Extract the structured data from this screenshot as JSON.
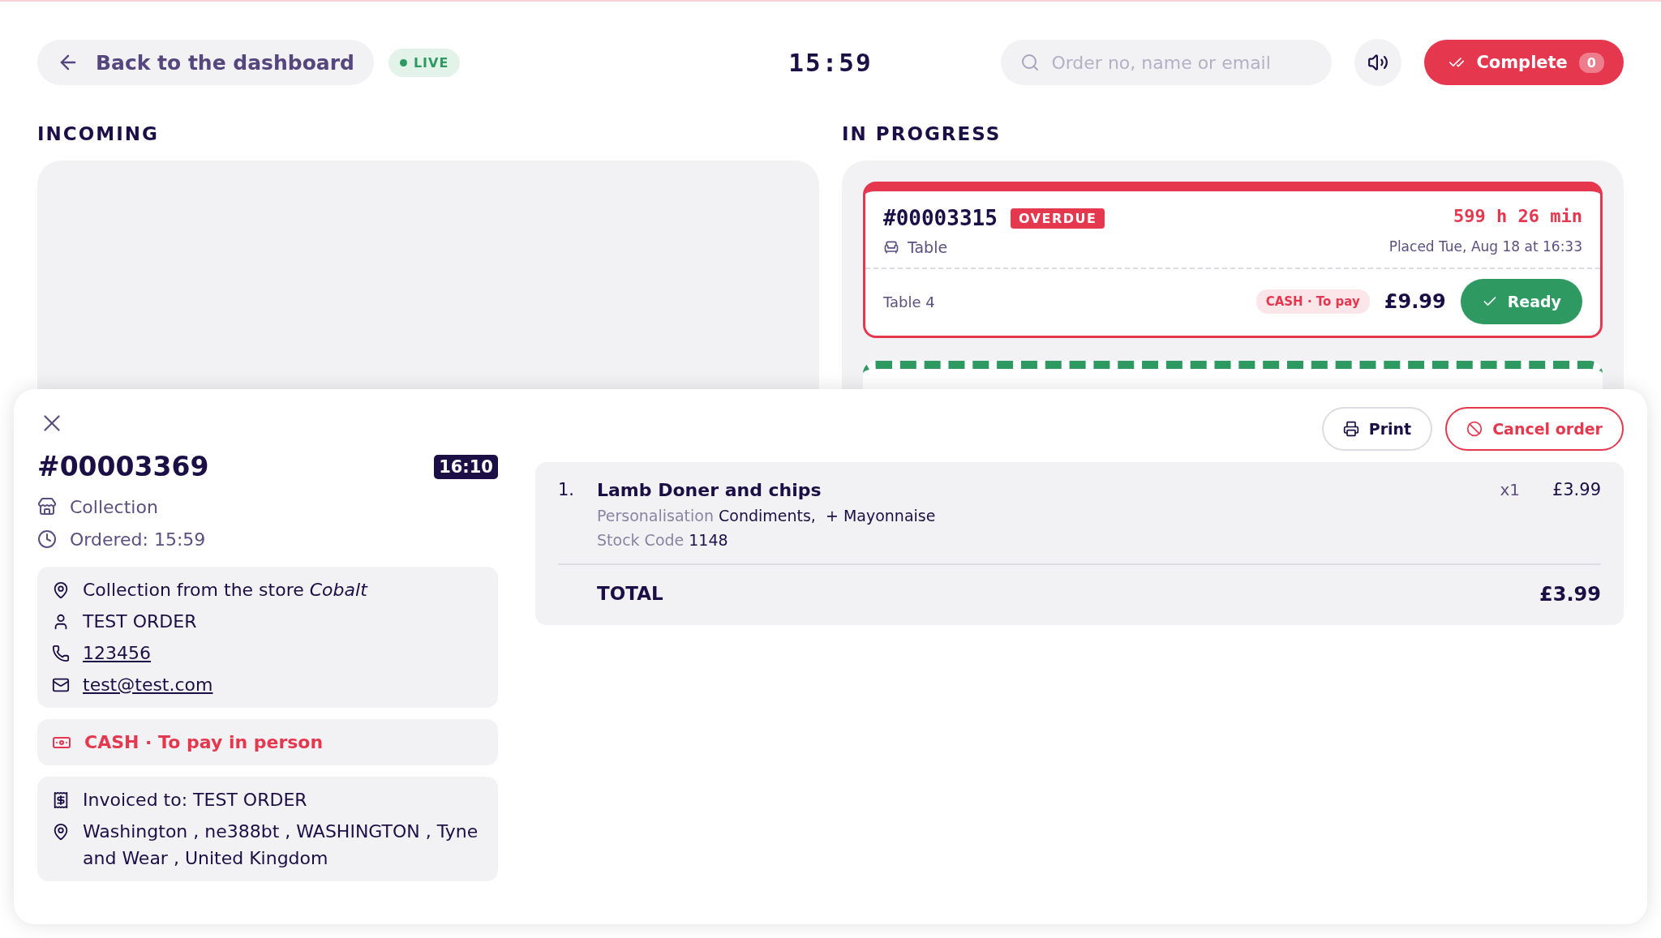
{
  "header": {
    "back_button": "Back to the dashboard",
    "live_badge": "LIVE",
    "clock": "15:59",
    "search": {
      "placeholder": "Order no, name or email"
    },
    "complete_button": {
      "label": "Complete",
      "count": "0"
    }
  },
  "columns": [
    {
      "title": "INCOMING"
    },
    {
      "title": "IN PROGRESS",
      "orders": [
        {
          "kind": "overdue",
          "number": "#00003315",
          "badge": "OVERDUE",
          "timer": "599 h 26 min",
          "type": "Table",
          "placed": "Placed Tue, Aug 18 at 16:33",
          "table": "Table 4",
          "payment": "CASH · To pay",
          "price": "£9.99",
          "action": "Ready"
        },
        {
          "kind": "ready"
        }
      ]
    }
  ],
  "order_sheet": {
    "number": "#00003369",
    "due": "16:10",
    "fulfilment": "Collection",
    "ordered": "Ordered: 15:59",
    "contact": {
      "location": "Collection from the store *Cobalt*",
      "name": "TEST ORDER",
      "phone": "123456",
      "email": "test@test.com"
    },
    "payment": "CASH · To pay in person",
    "invoice": {
      "to": "Invoiced to: TEST ORDER",
      "address": "Washington , ne388bt , WASHINGTON , Tyne and Wear , United Kingdom"
    },
    "actions": {
      "print": "Print",
      "cancel": "Cancel order"
    },
    "items": [
      {
        "index": "1.",
        "name": "Lamb Doner and chips",
        "quantity": "x1",
        "price": "£3.99",
        "details": [
          {
            "label": "Personalisation",
            "value": "Condiments,  + Mayonnaise"
          },
          {
            "label": "Stock Code",
            "value": "1148"
          }
        ]
      }
    ],
    "total": {
      "label": "TOTAL",
      "value": "£3.99"
    }
  }
}
